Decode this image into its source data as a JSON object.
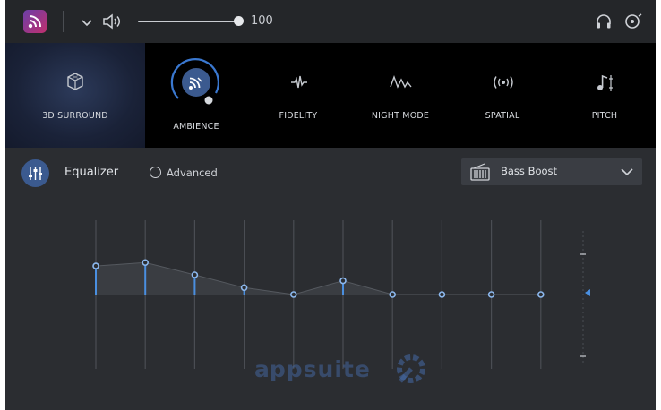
{
  "topbar": {
    "volume_value": "100",
    "icons": [
      "app-logo-icon",
      "chevron-down-icon",
      "speaker-icon",
      "headphones-icon",
      "settings-power-icon"
    ]
  },
  "effects": [
    {
      "id": "3d-surround",
      "label": "3D SURROUND",
      "icon": "cube-icon",
      "selected": true
    },
    {
      "id": "ambience",
      "label": "AMBIENCE",
      "icon": "ambience-icon",
      "active": true
    },
    {
      "id": "fidelity",
      "label": "FIDELITY",
      "icon": "waveform-icon"
    },
    {
      "id": "night-mode",
      "label": "NIGHT MODE",
      "icon": "wave-icon"
    },
    {
      "id": "spatial",
      "label": "SPATIAL",
      "icon": "spatial-icon"
    },
    {
      "id": "pitch",
      "label": "PITCH",
      "icon": "music-note-icon"
    }
  ],
  "equalizer": {
    "title": "Equalizer",
    "advanced_label": "Advanced",
    "advanced_checked": false,
    "preset": "Bass Boost",
    "band_gains": [
      0.58,
      0.65,
      0.4,
      0.14,
      0.0,
      0.28,
      0.0,
      0.0,
      0.0,
      0.0
    ]
  },
  "colors": {
    "accent": "#4a8fe0",
    "toggle_bg": "#3b5a8f",
    "panel": "#2b2d31"
  },
  "watermark": "a‌p‌p‌s"
}
